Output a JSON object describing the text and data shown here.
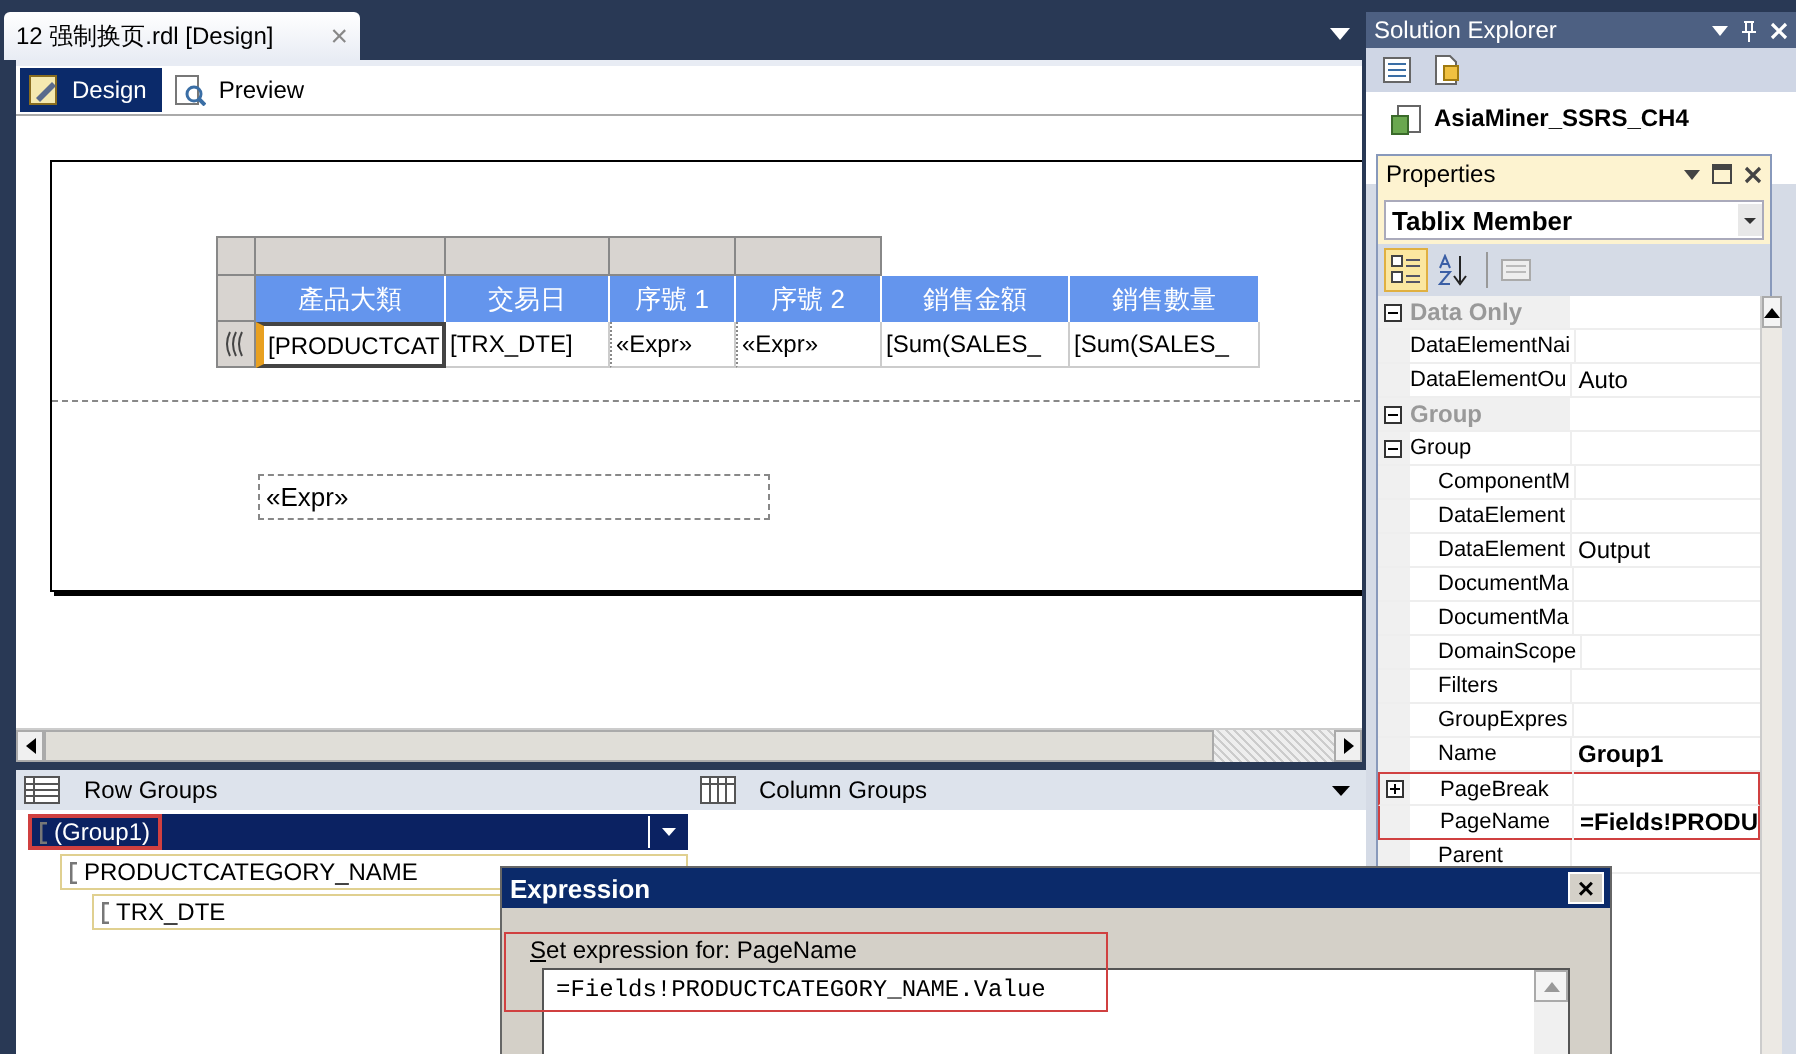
{
  "document_tab": {
    "title": "12 强制换页.rdl [Design]",
    "close": "×"
  },
  "view_tabs": [
    {
      "label": "Design",
      "selected": true
    },
    {
      "label": "Preview",
      "selected": false
    }
  ],
  "tablix": {
    "columns": [
      {
        "header": "產品大類",
        "value": "[PRODUCTCAT",
        "handle": true,
        "selected": true
      },
      {
        "header": "交易日",
        "value": "[TRX_DTE]",
        "handle": true,
        "selected": false
      },
      {
        "header": "序號 1",
        "value": "«Expr»",
        "handle": true,
        "selected": false
      },
      {
        "header": "序號 2",
        "value": "«Expr»",
        "handle": true,
        "selected": false
      },
      {
        "header": "銷售金額",
        "value": "[Sum(SALES_",
        "handle": false,
        "selected": false
      },
      {
        "header": "銷售數量",
        "value": "[Sum(SALES_",
        "handle": false,
        "selected": false
      }
    ]
  },
  "page_textbox": "«Expr»",
  "groups": {
    "row_title": "Row Groups",
    "column_title": "Column Groups",
    "row_groups": [
      {
        "label": "(Group1)",
        "selected": true,
        "highlighted": true,
        "children": [
          {
            "label": "PRODUCTCATEGORY_NAME",
            "selected": false,
            "highlighted": false,
            "children": [
              {
                "label": "TRX_DTE",
                "selected": false,
                "highlighted": false
              }
            ]
          }
        ]
      }
    ]
  },
  "solution_explorer": {
    "title": "Solution Explorer",
    "project": "AsiaMiner_SSRS_CH4"
  },
  "properties": {
    "title": "Properties",
    "object": "Tablix Member",
    "categorized": true,
    "rows": [
      {
        "kind": "category",
        "name": "Data Only",
        "expanded": true,
        "children": [
          {
            "kind": "property",
            "name": "DataElementNai",
            "highlighted": false
          },
          {
            "kind": "property",
            "name": "DataElementOu",
            "value": "Auto",
            "modified": false,
            "highlighted": false
          }
        ]
      },
      {
        "kind": "category",
        "name": "Group",
        "expanded": true,
        "children": [
          {
            "kind": "property",
            "name": "Group",
            "expanded": true,
            "highlighted": false,
            "children": [
              {
                "kind": "property",
                "name": "ComponentM",
                "highlighted": false
              },
              {
                "kind": "property",
                "name": "DataElement",
                "highlighted": false
              },
              {
                "kind": "property",
                "name": "DataElement",
                "value": "Output",
                "modified": false,
                "highlighted": false
              },
              {
                "kind": "property",
                "name": "DocumentMa",
                "highlighted": false
              },
              {
                "kind": "property",
                "name": "DocumentMa",
                "highlighted": false
              },
              {
                "kind": "property",
                "name": "DomainScope",
                "highlighted": false
              },
              {
                "kind": "property",
                "name": "Filters",
                "highlighted": false
              },
              {
                "kind": "property",
                "name": "GroupExpres",
                "highlighted": false
              },
              {
                "kind": "property",
                "name": "Name",
                "value": "Group1",
                "modified": true,
                "highlighted": false
              },
              {
                "kind": "property",
                "name": "PageBreak",
                "expanded": false,
                "highlighted": true
              },
              {
                "kind": "property",
                "name": "PageName",
                "value": "=Fields!PRODU",
                "modified": true,
                "highlighted": true
              },
              {
                "kind": "property",
                "name": "Parent",
                "highlighted": false
              }
            ]
          }
        ]
      }
    ]
  },
  "expression_dialog": {
    "title": "Expression",
    "close": "×",
    "label": "Set expression for: PageName",
    "value": "=Fields!PRODUCTCATEGORY_NAME.Value"
  }
}
